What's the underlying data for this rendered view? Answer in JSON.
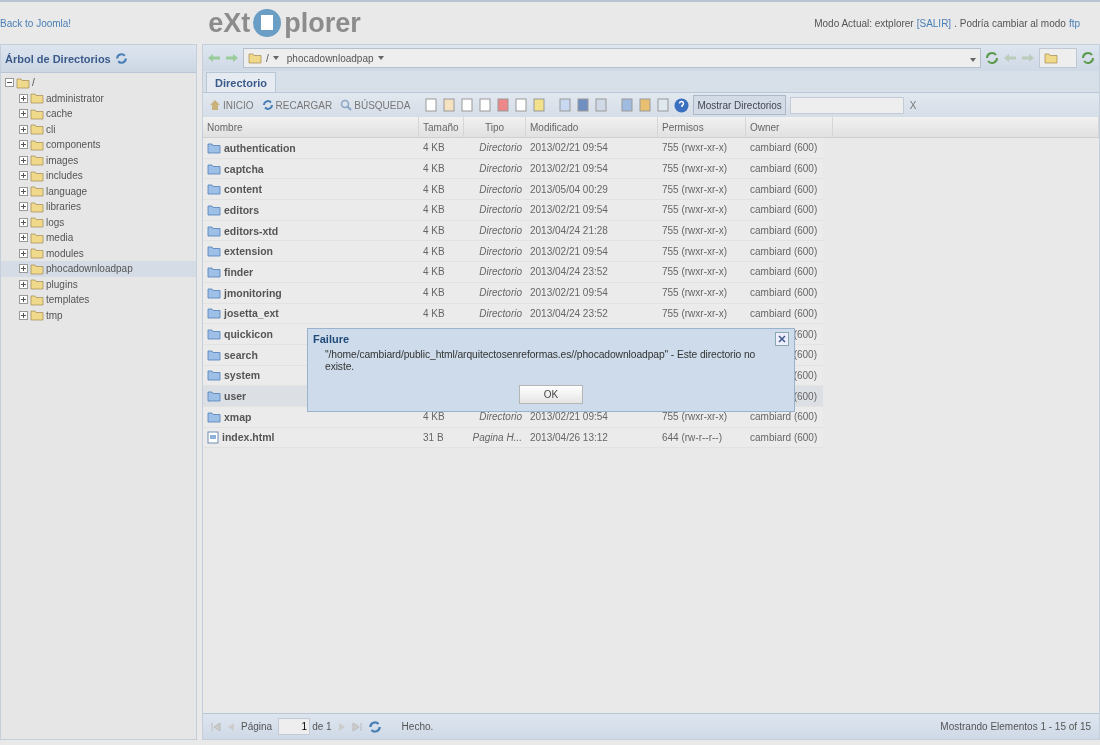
{
  "header": {
    "back_link": "Back to Joomla!",
    "logo_left": "eXt",
    "logo_right": "plorer",
    "mode_label": "Modo Actual: extplorer",
    "logout_link": "[SALIR]",
    "switch_label": ". Podría cambiar al modo",
    "ftp_link": "ftp"
  },
  "tree": {
    "title": "Árbol de Directorios",
    "root": {
      "label": "/",
      "expanded": true,
      "children": [
        {
          "label": "administrator",
          "selected": false
        },
        {
          "label": "cache",
          "selected": false
        },
        {
          "label": "cli",
          "selected": false
        },
        {
          "label": "components",
          "selected": false
        },
        {
          "label": "images",
          "selected": false
        },
        {
          "label": "includes",
          "selected": false
        },
        {
          "label": "language",
          "selected": false
        },
        {
          "label": "libraries",
          "selected": false
        },
        {
          "label": "logs",
          "selected": false
        },
        {
          "label": "media",
          "selected": false
        },
        {
          "label": "modules",
          "selected": false
        },
        {
          "label": "phocadownloadpap",
          "selected": true
        },
        {
          "label": "plugins",
          "selected": false
        },
        {
          "label": "templates",
          "selected": false
        },
        {
          "label": "tmp",
          "selected": false
        }
      ]
    }
  },
  "pathbar": {
    "root": "/",
    "path": "phocadownloadpap"
  },
  "tabs": [
    {
      "label": "Directorio",
      "selected": true
    }
  ],
  "toolbar": {
    "buttons": [
      {
        "label": "INICIO",
        "kind": "home"
      },
      {
        "label": "RECARGAR",
        "kind": "reload"
      },
      {
        "label": "BÚSQUEDA",
        "kind": "search"
      }
    ],
    "show_dirs": "Mostrar Directorios",
    "clear": "X"
  },
  "columns": [
    "Nombre",
    "Tamaño",
    "Tipo",
    "Modificado",
    "Permisos",
    "Owner"
  ],
  "rows": [
    {
      "kind": "folder",
      "name": "authentication",
      "size": "4 KB",
      "type": "Directorio",
      "modified": "2013/02/21 09:54",
      "perms": "755 (rwxr-xr-x)",
      "owner": "cambiard (600)",
      "covered": false,
      "selected": false
    },
    {
      "kind": "folder",
      "name": "captcha",
      "size": "4 KB",
      "type": "Directorio",
      "modified": "2013/02/21 09:54",
      "perms": "755 (rwxr-xr-x)",
      "owner": "cambiard (600)",
      "covered": false,
      "selected": false
    },
    {
      "kind": "folder",
      "name": "content",
      "size": "4 KB",
      "type": "Directorio",
      "modified": "2013/05/04 00:29",
      "perms": "755 (rwxr-xr-x)",
      "owner": "cambiard (600)",
      "covered": false,
      "selected": false
    },
    {
      "kind": "folder",
      "name": "editors",
      "size": "4 KB",
      "type": "Directorio",
      "modified": "2013/02/21 09:54",
      "perms": "755 (rwxr-xr-x)",
      "owner": "cambiard (600)",
      "covered": false,
      "selected": false
    },
    {
      "kind": "folder",
      "name": "editors-xtd",
      "size": "4 KB",
      "type": "Directorio",
      "modified": "2013/04/24 21:28",
      "perms": "755 (rwxr-xr-x)",
      "owner": "cambiard (600)",
      "covered": false,
      "selected": false
    },
    {
      "kind": "folder",
      "name": "extension",
      "size": "4 KB",
      "type": "Directorio",
      "modified": "2013/02/21 09:54",
      "perms": "755 (rwxr-xr-x)",
      "owner": "cambiard (600)",
      "covered": false,
      "selected": false
    },
    {
      "kind": "folder",
      "name": "finder",
      "size": "4 KB",
      "type": "Directorio",
      "modified": "2013/04/24 23:52",
      "perms": "755 (rwxr-xr-x)",
      "owner": "cambiard (600)",
      "covered": false,
      "selected": false
    },
    {
      "kind": "folder",
      "name": "jmonitoring",
      "size": "4 KB",
      "type": "Directorio",
      "modified": "2013/02/21 09:54",
      "perms": "755 (rwxr-xr-x)",
      "owner": "cambiard (600)",
      "covered": false,
      "selected": false
    },
    {
      "kind": "folder",
      "name": "josetta_ext",
      "size": "4 KB",
      "type": "Directorio",
      "modified": "2013/04/24 23:52",
      "perms": "755 (rwxr-xr-x)",
      "owner": "cambiard (600)",
      "covered": false,
      "selected": false
    },
    {
      "kind": "folder",
      "name": "quickicon",
      "owner": "(600)",
      "covered": true,
      "selected": false
    },
    {
      "kind": "folder",
      "name": "search",
      "owner": "(600)",
      "covered": true,
      "selected": false
    },
    {
      "kind": "folder",
      "name": "system",
      "owner": "(600)",
      "covered": true,
      "selected": false
    },
    {
      "kind": "folder",
      "name": "user",
      "owner": "(600)",
      "covered": true,
      "selected": true
    },
    {
      "kind": "folder",
      "name": "xmap",
      "size": "4 KB",
      "type": "Directorio",
      "modified": "2013/02/21 09:54",
      "perms": "755 (rwxr-xr-x)",
      "owner": "cambiard (600)",
      "covered": false,
      "selected": false
    },
    {
      "kind": "file",
      "name": "index.html",
      "size": "31 B",
      "type": "Pagina H...",
      "modified": "2013/04/26 13:12",
      "perms": "644 (rw-r--r--)",
      "owner": "cambiard (600)",
      "covered": false,
      "selected": false
    }
  ],
  "dialog": {
    "title": "Failure",
    "message": "\"/home/cambiard/public_html/arquitectosenreformas.es//phocadownloadpap\" - Este directorio no existe.",
    "ok": "OK"
  },
  "paging": {
    "page_label": "Página",
    "page_value": "1",
    "of": "de 1",
    "status": "Hecho.",
    "summary": "Mostrando Elementos 1 - 15 of 15"
  }
}
